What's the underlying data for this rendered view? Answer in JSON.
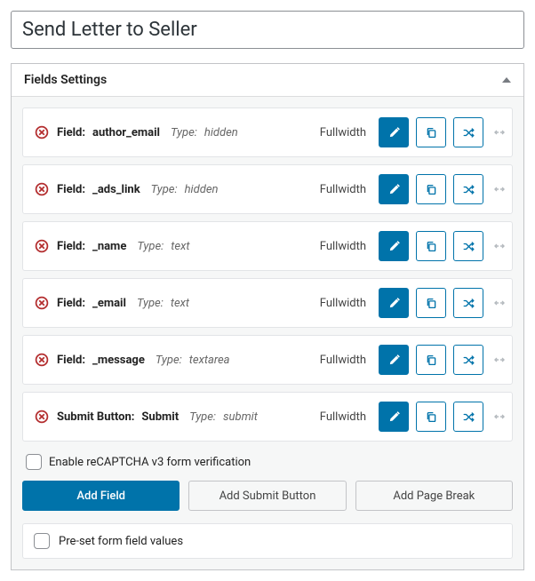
{
  "title": "Send Letter to Seller",
  "panel_title": "Fields Settings",
  "labels": {
    "field": "Field:",
    "submit_button": "Submit Button:",
    "type": "Type:",
    "fullwidth": "Fullwidth"
  },
  "fields": [
    {
      "kind": "field",
      "name": "author_email",
      "type": "hidden"
    },
    {
      "kind": "field",
      "name": "_ads_link",
      "type": "hidden"
    },
    {
      "kind": "field",
      "name": "_name",
      "type": "text"
    },
    {
      "kind": "field",
      "name": "_email",
      "type": "text"
    },
    {
      "kind": "field",
      "name": "_message",
      "type": "textarea"
    },
    {
      "kind": "submit",
      "name": "Submit",
      "type": "submit"
    }
  ],
  "checkboxes": {
    "recaptcha": "Enable reCAPTCHA v3 form verification",
    "preset": "Pre-set form field values"
  },
  "buttons": {
    "add_field": "Add Field",
    "add_submit": "Add Submit Button",
    "add_page_break": "Add Page Break"
  }
}
